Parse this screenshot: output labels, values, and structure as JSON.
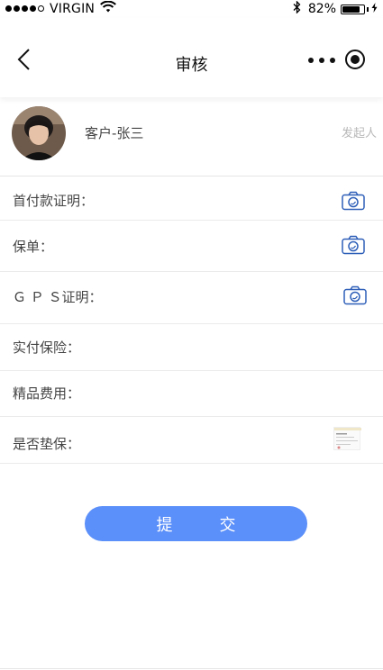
{
  "status_bar": {
    "carrier": "VIRGIN",
    "battery_percent": "82%",
    "battery_level": 0.82
  },
  "nav": {
    "title": "审核"
  },
  "initiator": {
    "customer_label": "客户-张三",
    "role_tag": "发起人"
  },
  "form": {
    "rows": [
      {
        "label": "首付款证明："
      },
      {
        "label": "保单："
      },
      {
        "label": "Ｇ Ｐ Ｓ证明："
      },
      {
        "label": "实付保险："
      },
      {
        "label": "精品费用："
      },
      {
        "label": "是否垫保："
      }
    ]
  },
  "submit_label": "提交",
  "colors": {
    "accent": "#5b8ff9",
    "camera_icon": "#2e5fb8"
  }
}
